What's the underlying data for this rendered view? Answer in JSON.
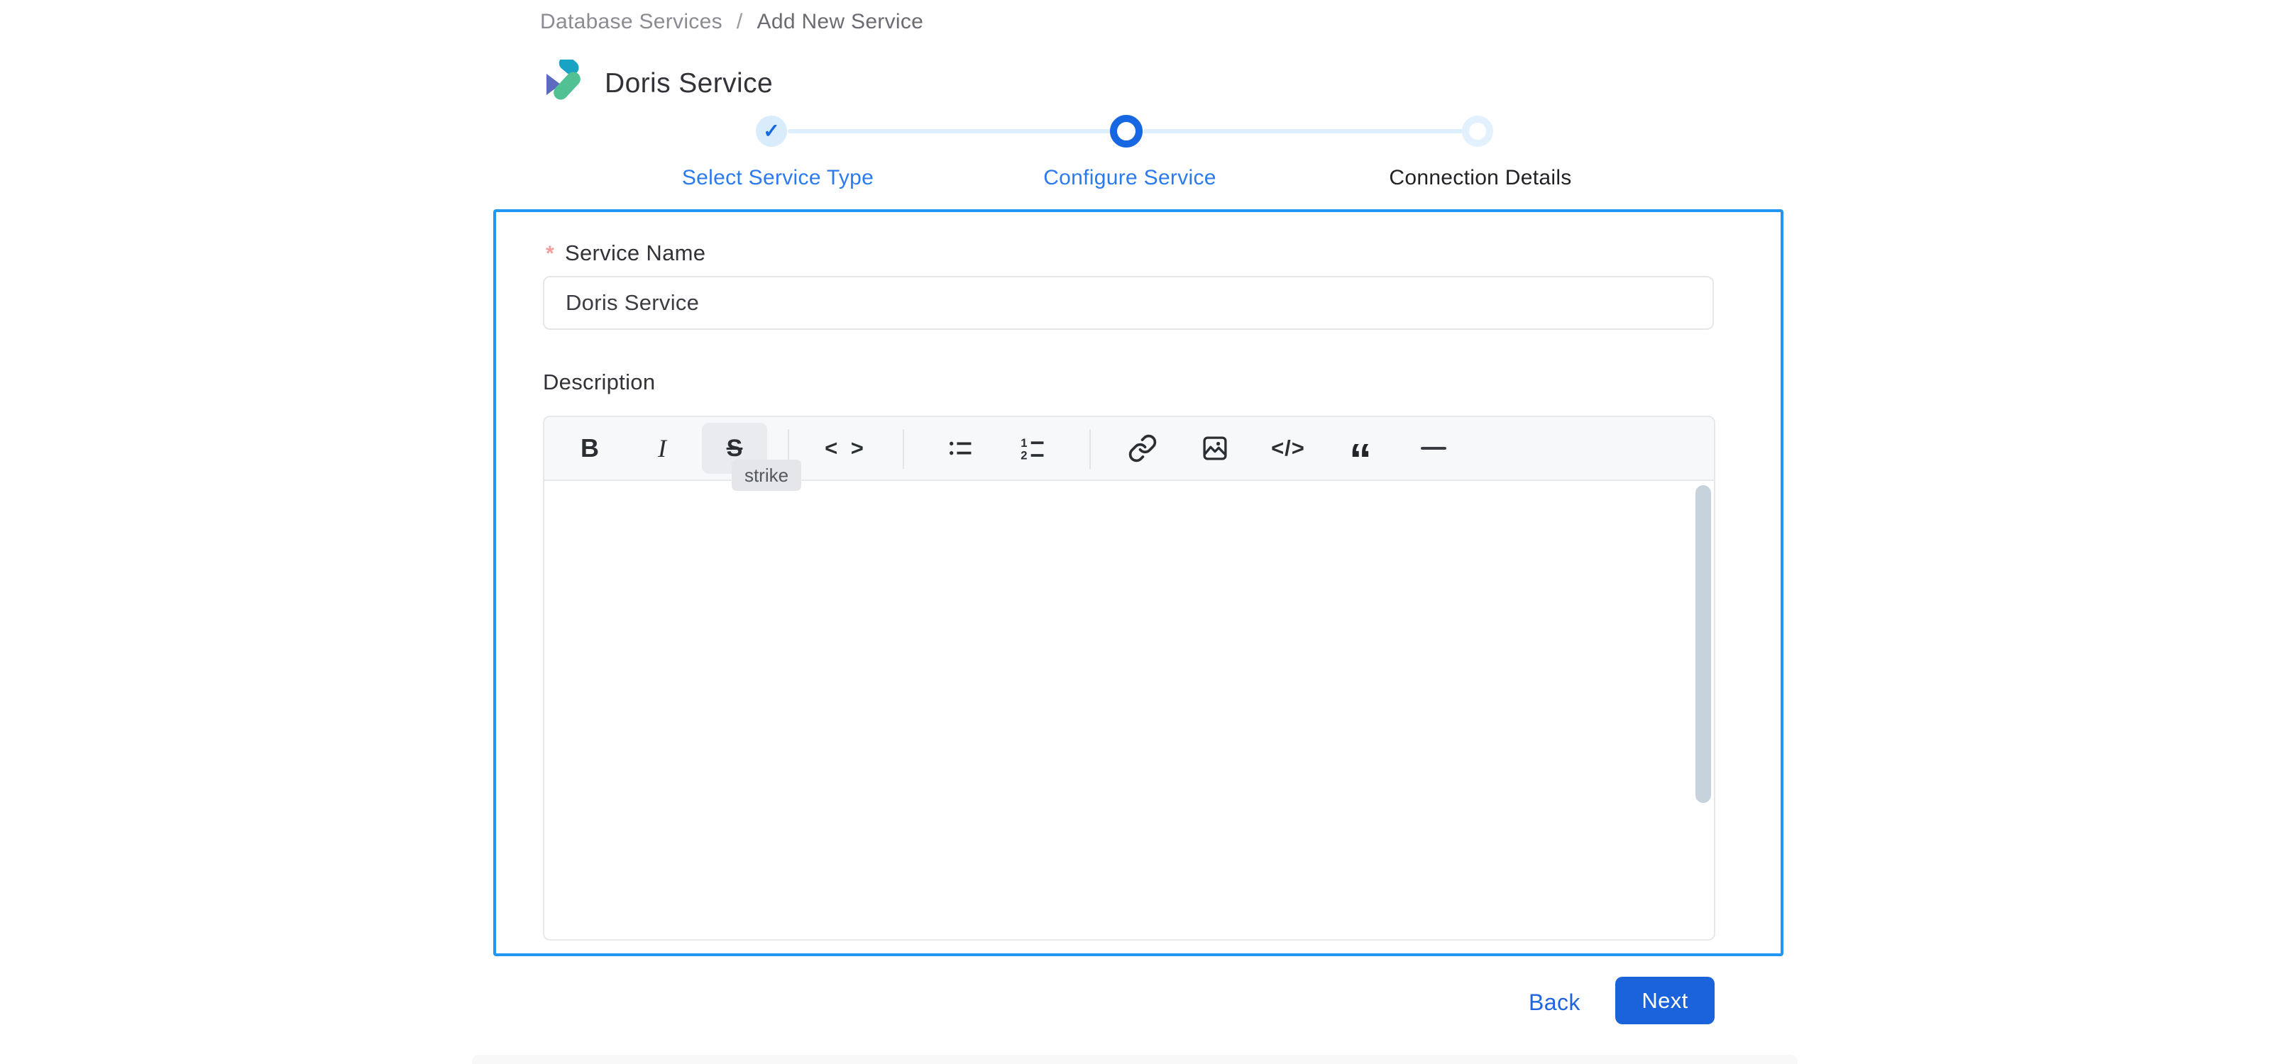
{
  "breadcrumb": {
    "items": [
      "Database Services",
      "Add New Service"
    ],
    "separator": "/"
  },
  "header": {
    "title": "Doris Service",
    "logo": "doris-logo"
  },
  "stepper": {
    "steps": [
      {
        "label": "Select Service Type",
        "state": "completed",
        "glyph": "✓"
      },
      {
        "label": "Configure Service",
        "state": "active"
      },
      {
        "label": "Connection Details",
        "state": "upcoming"
      }
    ]
  },
  "form": {
    "service_name": {
      "label": "Service Name",
      "required_marker": "*",
      "value": "Doris Service"
    },
    "description": {
      "label": "Description",
      "value": ""
    }
  },
  "editor": {
    "toolbar": {
      "buttons": [
        "bold",
        "italic",
        "strike",
        "inline-code",
        "bullet-list",
        "ordered-list",
        "link",
        "image",
        "code-block",
        "blockquote",
        "horizontal-rule"
      ],
      "bold_glyph": "B",
      "italic_glyph": "I",
      "strike_glyph": "S",
      "inline_code_glyph": "< >",
      "code_block_glyph": "</>",
      "quote_glyph": "“",
      "ordered_list_digits": [
        "1",
        "2"
      ]
    },
    "tooltip": {
      "text": "strike"
    }
  },
  "actions": {
    "back_label": "Back",
    "next_label": "Next"
  },
  "colors": {
    "panel_border": "#2196f3",
    "primary_button_blue": "#1b63da",
    "step_active_blue": "#1766e2",
    "step_light_blue": "#d9ecfb",
    "step_label_blue": "#2b7bee",
    "link_blue": "#2065e0",
    "required_marker_red": "#f39d9d",
    "toolbar_bg": "#f7f8fa",
    "scrollbar_thumb": "#c6d3dd"
  }
}
